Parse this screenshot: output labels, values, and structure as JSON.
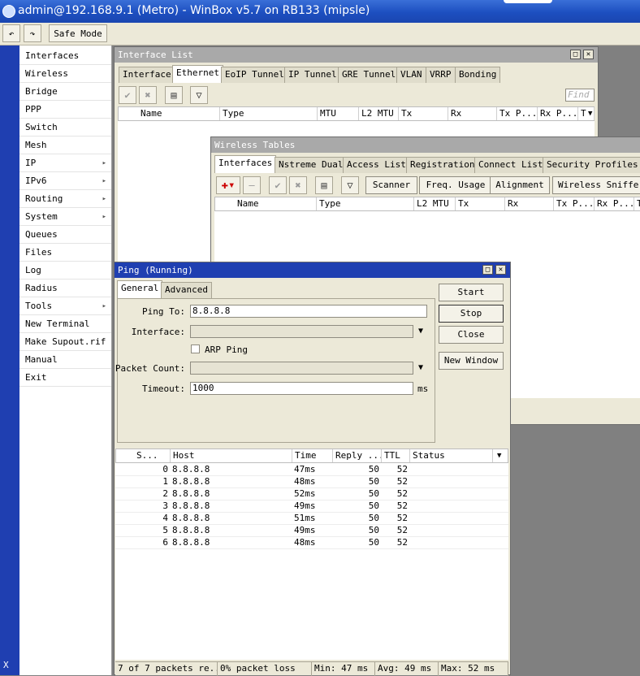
{
  "app": {
    "title": "admin@192.168.9.1 (Metro) - WinBox v5.7 on RB133 (mipsle)",
    "side_label": "X"
  },
  "toolbar": {
    "undo_icon": "undo-icon",
    "redo_icon": "redo-icon",
    "safe_mode": "Safe Mode"
  },
  "menu": [
    {
      "label": "Interfaces",
      "sub": false
    },
    {
      "label": "Wireless",
      "sub": false
    },
    {
      "label": "Bridge",
      "sub": false
    },
    {
      "label": "PPP",
      "sub": false
    },
    {
      "label": "Switch",
      "sub": false
    },
    {
      "label": "Mesh",
      "sub": false
    },
    {
      "label": "IP",
      "sub": true
    },
    {
      "label": "IPv6",
      "sub": true
    },
    {
      "label": "Routing",
      "sub": true
    },
    {
      "label": "System",
      "sub": true
    },
    {
      "label": "Queues",
      "sub": false
    },
    {
      "label": "Files",
      "sub": false
    },
    {
      "label": "Log",
      "sub": false
    },
    {
      "label": "Radius",
      "sub": false
    },
    {
      "label": "Tools",
      "sub": true
    },
    {
      "label": "New Terminal",
      "sub": false
    },
    {
      "label": "Make Supout.rif",
      "sub": false
    },
    {
      "label": "Manual",
      "sub": false
    },
    {
      "label": "Exit",
      "sub": false
    }
  ],
  "interface_list": {
    "title": "Interface List",
    "tabs": [
      "Interface",
      "Ethernet",
      "EoIP Tunnel",
      "IP Tunnel",
      "GRE Tunnel",
      "VLAN",
      "VRRP",
      "Bonding"
    ],
    "selected_tab": "Ethernet",
    "find_placeholder": "Find",
    "columns": [
      "Name",
      "Type",
      "MTU",
      "L2 MTU",
      "Tx",
      "Rx",
      "Tx P...",
      "Rx P...",
      "T"
    ]
  },
  "wireless_tables": {
    "title": "Wireless Tables",
    "tabs": [
      "Interfaces",
      "Nstreme Dual",
      "Access List",
      "Registration",
      "Connect List",
      "Security Profiles"
    ],
    "selected_tab": "Interfaces",
    "buttons": [
      "Scanner",
      "Freq. Usage",
      "Alignment",
      "Wireless Sniffer"
    ],
    "columns": [
      "Name",
      "Type",
      "L2 MTU",
      "Tx",
      "Rx",
      "Tx P...",
      "Rx P...",
      "T"
    ]
  },
  "ping": {
    "title": "Ping (Running)",
    "tabs": [
      "General",
      "Advanced"
    ],
    "selected_tab": "General",
    "labels": {
      "ping_to": "Ping To:",
      "interface": "Interface:",
      "arp_ping": "ARP Ping",
      "packet_count": "Packet Count:",
      "timeout": "Timeout:",
      "timeout_unit": "ms"
    },
    "values": {
      "ping_to": "8.8.8.8",
      "interface": "",
      "arp_ping": false,
      "packet_count": "",
      "timeout": "1000"
    },
    "buttons": [
      "Start",
      "Stop",
      "Close",
      "New Window"
    ],
    "columns": [
      "S...",
      "Host",
      "Time",
      "Reply ...",
      "TTL",
      "Status"
    ],
    "rows": [
      {
        "seq": "0",
        "host": "8.8.8.8",
        "time": "47ms",
        "reply": "50",
        "ttl": "52",
        "status": ""
      },
      {
        "seq": "1",
        "host": "8.8.8.8",
        "time": "48ms",
        "reply": "50",
        "ttl": "52",
        "status": ""
      },
      {
        "seq": "2",
        "host": "8.8.8.8",
        "time": "52ms",
        "reply": "50",
        "ttl": "52",
        "status": ""
      },
      {
        "seq": "3",
        "host": "8.8.8.8",
        "time": "49ms",
        "reply": "50",
        "ttl": "52",
        "status": ""
      },
      {
        "seq": "4",
        "host": "8.8.8.8",
        "time": "51ms",
        "reply": "50",
        "ttl": "52",
        "status": ""
      },
      {
        "seq": "5",
        "host": "8.8.8.8",
        "time": "49ms",
        "reply": "50",
        "ttl": "52",
        "status": ""
      },
      {
        "seq": "6",
        "host": "8.8.8.8",
        "time": "48ms",
        "reply": "50",
        "ttl": "52",
        "status": ""
      }
    ],
    "status": {
      "packets": "7 of 7 packets re...",
      "loss": "0% packet loss",
      "min": "Min: 47 ms",
      "avg": "Avg: 49 ms",
      "max": "Max: 52 ms"
    }
  },
  "colors": {
    "title_active": "#1f3fb1",
    "title_inactive": "#a9a9a9",
    "add_icon": "#cc0000"
  }
}
